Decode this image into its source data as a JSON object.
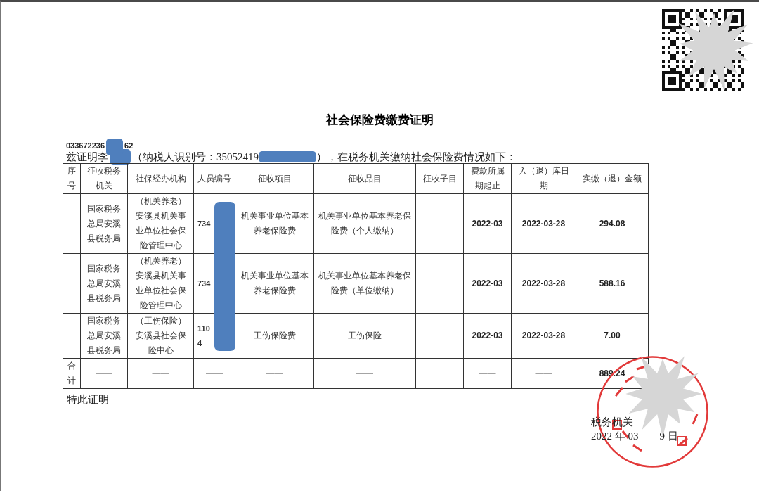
{
  "document": {
    "title": "社会保险费缴费证明",
    "reference_number_parts": [
      "033672236",
      "62"
    ],
    "statement_parts": [
      "兹证明李",
      "（纳税人识别号：35052419",
      "），在税务机关缴纳社会保险费情况如下："
    ],
    "table": {
      "columns": [
        "序号",
        "征收税务机关",
        "社保经办机构",
        "人员编号",
        "征收项目",
        "征收品目",
        "征收子目",
        "费款所属期起止",
        "入（退）库日期",
        "实缴（退）金额"
      ],
      "rows": [
        {
          "cells": [
            null,
            "国家税务总局安溪县税务局",
            "（机关养老）安溪县机关事业单位社会保险管理中心",
            "734",
            "机关事业单位基本养老保险费",
            "机关事业单位基本养老保险费（个人缴纳）",
            null,
            "2022-03",
            "2022-03-28",
            "294.08"
          ]
        },
        {
          "cells": [
            null,
            "国家税务总局安溪县税务局",
            "（机关养老）安溪县机关事业单位社会保险管理中心",
            "734",
            "机关事业单位基本养老保险费",
            "机关事业单位基本养老保险费（单位缴纳）",
            null,
            "2022-03",
            "2022-03-28",
            "588.16"
          ]
        },
        {
          "cells": [
            null,
            "国家税务总局安溪县税务局",
            "（工伤保险）安溪县社会保险中心",
            "110\n4",
            "工伤保险费",
            "工伤保险",
            null,
            "2022-03",
            "2022-03-28",
            "7.00"
          ]
        }
      ],
      "total": {
        "cells": [
          "合计",
          "——",
          "——",
          "——",
          "——",
          "——",
          null,
          "——",
          "——",
          "889.24"
        ]
      }
    },
    "closing": "特此证明",
    "signature": {
      "authority": "税务机关",
      "date_parts": [
        "2022 年 03",
        "9 日"
      ]
    }
  }
}
